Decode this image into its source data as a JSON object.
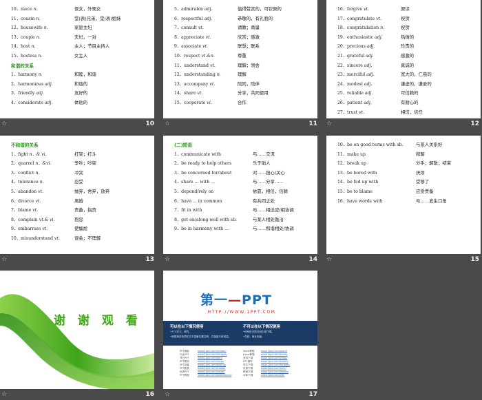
{
  "slides": [
    {
      "num": "10",
      "heading_after": 5,
      "heading": "和谐的关系",
      "rows": [
        [
          "10．niece ",
          "n.",
          "侄女，外甥女"
        ],
        [
          "11．cousin ",
          "n.",
          "堂(表)兄弟，堂(表)姐妹"
        ],
        [
          "12．housewife ",
          "n.",
          "家庭主妇"
        ],
        [
          "13．couple ",
          "n.",
          "夫妇，一对"
        ],
        [
          "14．host ",
          "n.",
          "主人；节目主持人"
        ],
        [
          "15．hostess ",
          "n.",
          "女主人"
        ],
        [
          "1．harmony ",
          "n.",
          "和睦，和谐"
        ],
        [
          "2．harmonious ",
          "adj.",
          "和谐的"
        ],
        [
          "3．friendly ",
          "adj.",
          "友好的"
        ],
        [
          "4．considerate ",
          "adj.",
          "体贴的"
        ]
      ]
    },
    {
      "num": "11",
      "heading_after": -1,
      "heading": "",
      "rows": [
        [
          "5．admirable ",
          "adj.",
          "值得赞赏的，可钦佩的"
        ],
        [
          "6．respectful ",
          "adj.",
          "恭敬的，有礼貌的"
        ],
        [
          "7．consult ",
          "vt.",
          "请教；商量"
        ],
        [
          "8．appreciate ",
          "vt.",
          "欣赏；感激"
        ],
        [
          "9．associate ",
          "vt.",
          "联想；联系"
        ],
        [
          "10．respect ",
          "vt.&n.",
          "尊重"
        ],
        [
          "11．understand ",
          "vt.",
          "理解；领会"
        ],
        [
          "12．understanding ",
          "n.",
          "理解"
        ],
        [
          "13．accompany ",
          "vt.",
          "陪同，陪伴"
        ],
        [
          "14．share ",
          "vt.",
          "分享，共同使用"
        ],
        [
          "15．cooperate ",
          "vi.",
          "合作"
        ]
      ]
    },
    {
      "num": "12",
      "heading_after": -1,
      "heading": "",
      "rows": [
        [
          "16．forgive ",
          "vt.",
          "原谅"
        ],
        [
          "17．congratulate ",
          "vt.",
          "祝贺"
        ],
        [
          "18．congratulation ",
          "n.",
          "祝贺"
        ],
        [
          "19．enthusiastic ",
          "adj.",
          "热情的"
        ],
        [
          "20．precious ",
          "adj.",
          "珍贵的"
        ],
        [
          "21．grateful ",
          "adj.",
          "感激的"
        ],
        [
          "22．sincere ",
          "adj.",
          "真诚的"
        ],
        [
          "23．merciful ",
          "adj.",
          "宽大的，仁慈的"
        ],
        [
          "24．modest ",
          "adj.",
          "谦虚的，谦逊的"
        ],
        [
          "25．reliable ",
          "adj.",
          "可信赖的"
        ],
        [
          "26．patient ",
          "adj.",
          "有耐心的"
        ],
        [
          "27．trust ",
          "vt.",
          "相信，信任"
        ]
      ]
    },
    {
      "num": "13",
      "heading_after": -2,
      "heading": "不和谐的关系",
      "rows": [
        [
          "1．fight ",
          "n．& vi.",
          "打架；打斗"
        ],
        [
          "2．quarrel ",
          "n．&vi.",
          "争吵；吵架"
        ],
        [
          "3．conflict ",
          "n.",
          "冲突"
        ],
        [
          "4．tolerance ",
          "n.",
          "忍受"
        ],
        [
          "5．abandon ",
          "vt.",
          "抛弃，舍弃，放弃"
        ],
        [
          "6．divorce ",
          "vt.",
          "离婚"
        ],
        [
          "7．blame ",
          "vt.",
          "责备，指责"
        ],
        [
          "8．complain ",
          "vt.& vi.",
          "抱怨"
        ],
        [
          "9．embarrass ",
          "vt.",
          "使尴尬"
        ],
        [
          "10．misunderstand ",
          "vt.",
          "误会；不理解"
        ]
      ]
    },
    {
      "num": "14",
      "heading_after": -2,
      "heading": "(二)短语",
      "rows": [
        [
          "1．communicate with",
          "",
          "与……交流"
        ],
        [
          "2．be ready to help others",
          "",
          "乐于助人"
        ],
        [
          "3．be concerned for/about",
          "",
          "对……担心/关心"
        ],
        [
          "4．share ... with ...",
          "",
          "与……分享……"
        ],
        [
          "5．depend/rely on",
          "",
          "依靠，相信，信赖"
        ],
        [
          "6．have ... in common",
          "",
          "有共同之处"
        ],
        [
          "7．fit in with",
          "",
          "与……相适应/相协调"
        ],
        [
          "8．get on/along well with sb.",
          "",
          "与某人相处融洽"
        ],
        [
          "9．be in harmony with ...",
          "",
          "与……和谐相处/协调"
        ]
      ]
    },
    {
      "num": "15",
      "heading_after": -1,
      "heading": "",
      "rows": [
        [
          "10．be on good terms with sb.",
          "",
          "与某人关系好"
        ],
        [
          "11．make up",
          "",
          "和解"
        ],
        [
          "12．break up",
          "",
          "分手；解散；结束"
        ],
        [
          "13．be bored with",
          "",
          "厌烦"
        ],
        [
          "14．be fed up with",
          "",
          "受够了"
        ],
        [
          "15．be to blame",
          "",
          "应受责备"
        ],
        [
          "16．have words with",
          "",
          "与……发生口角"
        ]
      ]
    }
  ],
  "slide16": {
    "num": "16",
    "thanks": "谢 谢 观 看"
  },
  "slide17": {
    "num": "17",
    "logo_a": "第一",
    "logo_b": "PPT",
    "url": "HTTP://WWW.1PPT.COM",
    "left_title": "可以在以下情况使用",
    "left_sub1": "•个人学习、研究。",
    "left_sub2": "•新型演讲但须在文中显著位置注明，并保留本页权益。",
    "right_title": "不可以在以下情况使用",
    "right_sub1": "•任何形式的在线付费下载。",
    "right_sub2": "•在线、商业用途。",
    "links": [
      [
        "PPT模板",
        "www.1ppt.com/moban/"
      ],
      [
        "行业PPT",
        "www.1ppt.com/hangye/"
      ],
      [
        "节日PPT",
        "www.1ppt.com/jieri/"
      ],
      [
        "PPT素材",
        "www.1ppt.com/sucai/"
      ],
      [
        "PPT背景",
        "www.1ppt.com/beijing/"
      ],
      [
        "PPT图表",
        "www.1ppt.com/tubiao/"
      ],
      [
        "优秀PPT",
        "www.1ppt.com/xiazai/"
      ],
      [
        "PPT教程",
        "www.1ppt.com/powerpoint/"
      ]
    ],
    "links2": [
      [
        "Word教程",
        "www.1ppt.com/word/"
      ],
      [
        "Excel教程",
        "www.1ppt.com/excel/"
      ],
      [
        "资料下载",
        "www.1ppt.com/ziliao/"
      ],
      [
        "PPT课件",
        "www.1ppt.com/kejian/"
      ],
      [
        "范文下载",
        "www.1ppt.com/fanwen/"
      ],
      [
        "试卷下载",
        "www.1ppt.com/shiti/"
      ],
      [
        "教案下载",
        "www.1ppt.com/jiaoan/"
      ],
      [
        "字体下载",
        "www.1ppt.com/ziti/"
      ]
    ]
  },
  "colors": {
    "heading_green": "#2a9a1a",
    "background": "#4a4a4a",
    "logo_blue": "#1d6fb4",
    "band": "#1b3a66"
  }
}
